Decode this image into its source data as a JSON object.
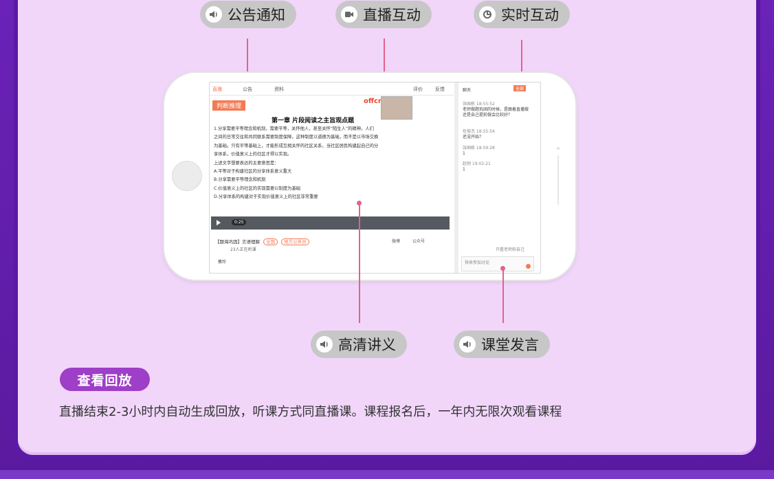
{
  "features": {
    "announce": {
      "label": "公告通知",
      "icon": "speaker-icon"
    },
    "live": {
      "label": "直播互动",
      "icon": "video-camera-icon"
    },
    "realtime": {
      "label": "实时互动",
      "icon": "chat-refresh-icon"
    },
    "lecture": {
      "label": "高清讲义",
      "icon": "speaker-icon"
    },
    "classroom": {
      "label": "课堂发言",
      "icon": "speaker-icon"
    }
  },
  "screen": {
    "tabs": [
      "直播",
      "公告",
      "资料"
    ],
    "tab_right": "评价",
    "tab_right2": "反馈",
    "tag": "判断推理",
    "logo": "offcn",
    "doc_title": "第一章 片段阅读之主旨观点题",
    "doc_lines": [
      "1.分享需要平等理念和机制，需要平等，关怀他人，甚至关怀“陌生人”的精神。人们",
      "之间的日常交往和共同联系需要制度保障，这种制度以道德为基础，而不是以市场交换",
      "为基础。只有平等基础上，才能形成互相关怀的社区关系，当社区居民构建起自己的分",
      "享体系，价值意义上的社区才得以实现。",
      "上述文字想要表达的主要意思是：",
      "A.平等对于构建社区的分享体系意义重大",
      "B.分享需要平等理念和机制",
      "C.价值意义上的社区的实现需要以制度为基础",
      "D.分享体系的构建对于实现价值意义上的社区非常重要"
    ],
    "player_time": "0:25",
    "course_title": "【题海巩固】言语理解",
    "course_badge1": "全国",
    "course_badge2": "地方公务员",
    "listeners": "23人正在听课",
    "teacher": "蔡玲",
    "share_weibo": "微博",
    "share_gzh": "公众号",
    "chat_header": "聊天",
    "chat_badge": "全部",
    "messages": [
      {
        "who": "张国栋 18:55:52",
        "text": "老师做题巩固的时候，是跟着直播做还是自己提前做会比较好？"
      },
      {
        "who": "任俊杰 18:55:54",
        "text": "还没开始？"
      },
      {
        "who": "张国栋 18:59:28",
        "text": "1"
      },
      {
        "who": "赵刚 19:02:21",
        "text": "1"
      }
    ],
    "chat_option": "只看老师和自己",
    "chat_placeholder": "快来参加讨论"
  },
  "replay": {
    "button_label": "查看回放",
    "description": "直播结束2-3小时内自动生成回放，听课方式同直播课。课程报名后，一年内无限次观看课程"
  },
  "colors": {
    "accent": "#9e3fc7",
    "connector": "#e2628c",
    "panel": "#f1d6fa",
    "frame": "#5b1aa6"
  }
}
